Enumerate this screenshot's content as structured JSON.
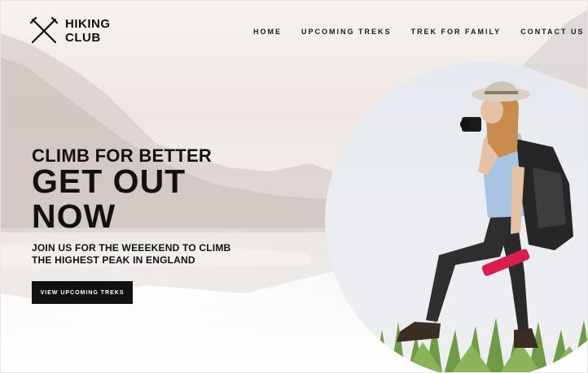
{
  "brand": {
    "line1": "HIKING",
    "line2": "CLUB",
    "icon": "crossed-trekking-poles-icon"
  },
  "nav": [
    {
      "label": "HOME"
    },
    {
      "label": "UPCOMING TREKS"
    },
    {
      "label": "TREK FOR FAMILY"
    },
    {
      "label": "CONTACT US"
    }
  ],
  "hero": {
    "kicker": "CLIMB FOR BETTER",
    "headline_line1": "GET OUT",
    "headline_line2": "NOW",
    "subtext_line1": "JOIN US FOR THE WEEEKEND TO CLIMB",
    "subtext_line2": "THE HIGHEST PEAK IN ENGLAND",
    "cta_label": "VIEW UPCOMING TREKS"
  },
  "colors": {
    "text": "#111111",
    "button_bg": "#111111",
    "button_text": "#ffffff",
    "bottle": "#d81e4a"
  }
}
